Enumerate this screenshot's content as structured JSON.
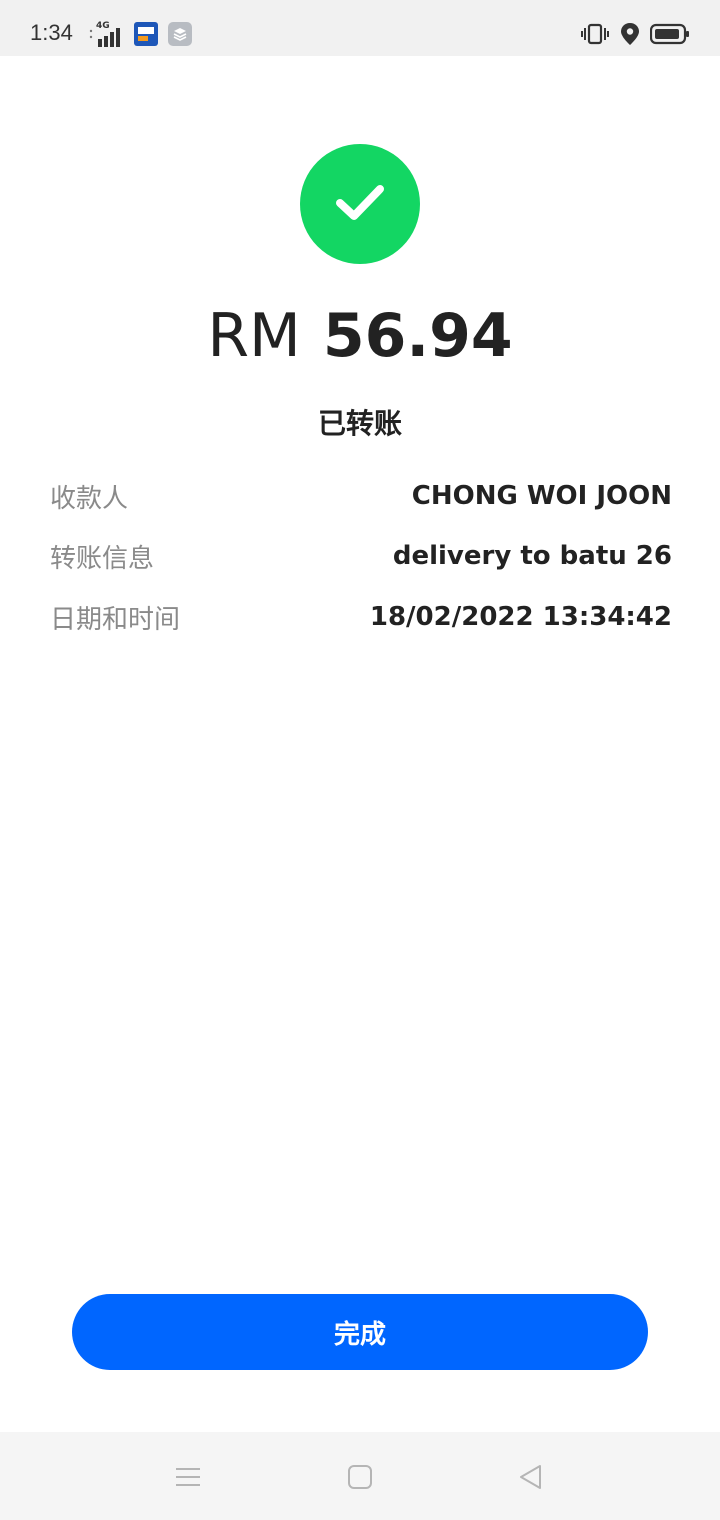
{
  "status_bar": {
    "time": "1:34",
    "network": "4G",
    "icons": [
      "signal-icon",
      "app-notification-icon",
      "layers-icon",
      "vibrate-icon",
      "location-icon",
      "battery-icon"
    ]
  },
  "receipt": {
    "status_icon": "check-icon",
    "currency": "RM",
    "amount": "56.94",
    "status_text": "已转账",
    "details": [
      {
        "label": "收款人",
        "value": "CHONG WOI JOON"
      },
      {
        "label": "转账信息",
        "value": "delivery to batu 26"
      },
      {
        "label": "日期和时间",
        "value": "18/02/2022 13:34:42"
      }
    ]
  },
  "actions": {
    "done_label": "完成"
  },
  "nav": {
    "items": [
      "menu-icon",
      "home-icon",
      "back-icon"
    ]
  },
  "colors": {
    "success": "#13d663",
    "primary": "#0066ff"
  }
}
